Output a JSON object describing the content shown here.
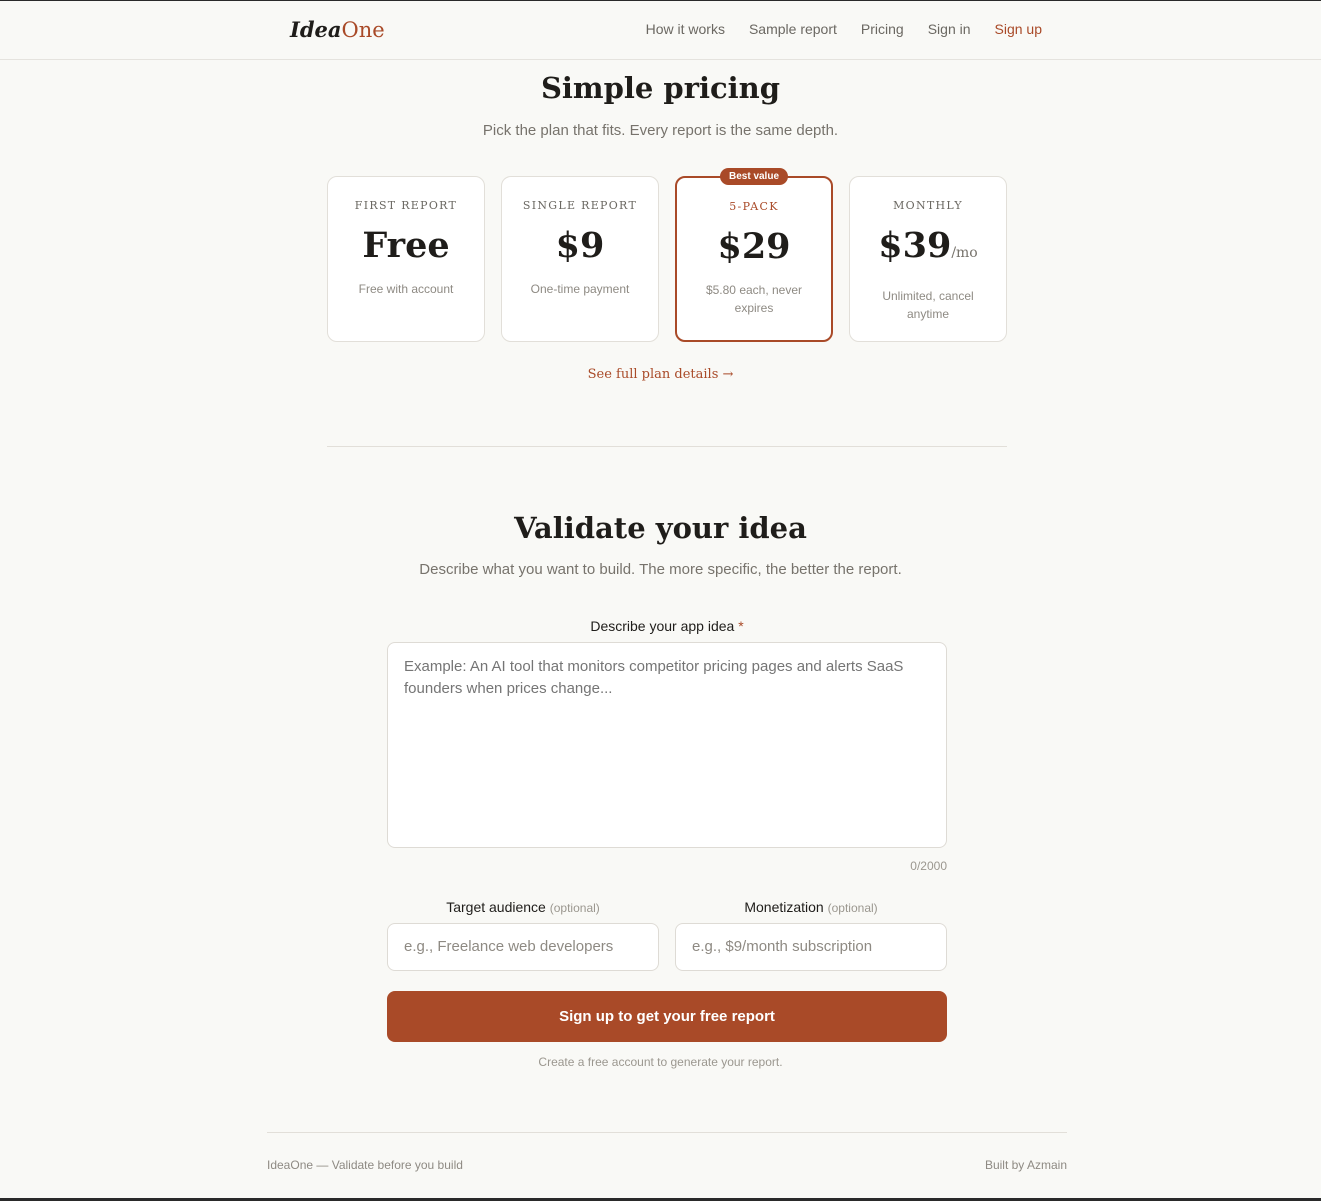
{
  "header": {
    "logo_part1": "Idea",
    "logo_part2": "One",
    "nav": [
      "How it works",
      "Sample report",
      "Pricing",
      "Sign in",
      "Sign up"
    ]
  },
  "pricing": {
    "title": "Simple pricing",
    "subtitle": "Pick the plan that fits. Every report is the same depth.",
    "plans": [
      {
        "name": "FIRST REPORT",
        "price": "Free",
        "unit": "",
        "note": "Free with account"
      },
      {
        "name": "SINGLE REPORT",
        "price": "$9",
        "unit": "",
        "note": "One-time payment"
      },
      {
        "name": "5-PACK",
        "price": "$29",
        "unit": "",
        "note": "$5.80 each, never expires",
        "badge": "Best value"
      },
      {
        "name": "MONTHLY",
        "price": "$39",
        "unit": "/mo",
        "note": "Unlimited, cancel anytime"
      }
    ],
    "details_link": "See full plan details →"
  },
  "validate": {
    "title": "Validate your idea",
    "subtitle": "Describe what you want to build. The more specific, the better the report.",
    "idea_label": "Describe your app idea",
    "required_mark": "*",
    "idea_placeholder": "Example: An AI tool that monitors competitor pricing pages and alerts SaaS founders when prices change...",
    "counter": "0/2000",
    "audience_label": "Target audience",
    "audience_optional": "(optional)",
    "audience_placeholder": "e.g., Freelance web developers",
    "monetization_label": "Monetization",
    "monetization_optional": "(optional)",
    "monetization_placeholder": "e.g., $9/month subscription",
    "cta": "Sign up to get your free report",
    "cta_note": "Create a free account to generate your report."
  },
  "footer": {
    "left": "IdeaOne — Validate before you build",
    "right": "Built by Azmain"
  },
  "colors": {
    "accent": "#a94a28",
    "background": "#f9f9f6"
  }
}
